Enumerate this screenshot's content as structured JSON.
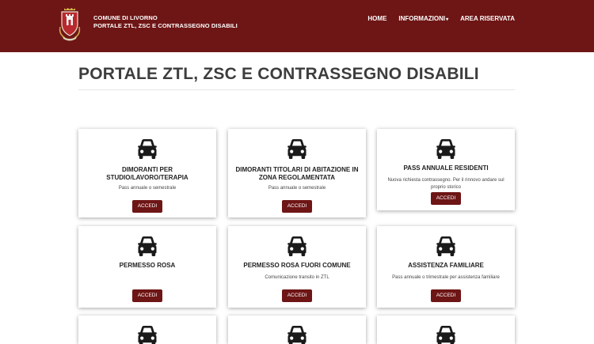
{
  "header": {
    "brand_line1": "COMUNE DI LIVORNO",
    "brand_line2": "PORTALE ZTL, ZSC E CONTRASSEGNO DISABILI",
    "nav": [
      {
        "label": "HOME"
      },
      {
        "label": "INFORMAZIONI"
      },
      {
        "label": "AREA RISERVATA"
      }
    ],
    "colors": {
      "brand": "#6e1515"
    }
  },
  "page": {
    "title": "PORTALE ZTL, ZSC E CONTRASSEGNO DISABILI"
  },
  "cards": [
    {
      "title": "DIMORANTI PER STUDIO/LAVORO/TERAPIA",
      "desc": "Pass annuale o semestrale",
      "button": "ACCEDI",
      "icon": "car-icon"
    },
    {
      "title": "DIMORANTI TITOLARI DI ABITAZIONE IN ZONA REGOLAMENTATA",
      "desc": "Pass annuale o semestrale",
      "button": "ACCEDI",
      "icon": "car-icon"
    },
    {
      "title": "PASS ANNUALE RESIDENTI",
      "desc": "Nuova richiesta contrassegno. Per il rinnovo andare sul proprio storico",
      "button": "ACCEDI",
      "icon": "car-icon"
    },
    {
      "title": "PERMESSO ROSA",
      "desc": "",
      "button": "ACCEDI",
      "icon": "car-icon"
    },
    {
      "title": "PERMESSO ROSA FUORI COMUNE",
      "desc": "Comunicazione transito in ZTL",
      "button": "ACCEDI",
      "icon": "car-icon"
    },
    {
      "title": "ASSISTENZA FAMILIARE",
      "desc": "Pass annuale o trimestrale per assistenza familiare",
      "button": "ACCEDI",
      "icon": "car-icon"
    }
  ]
}
